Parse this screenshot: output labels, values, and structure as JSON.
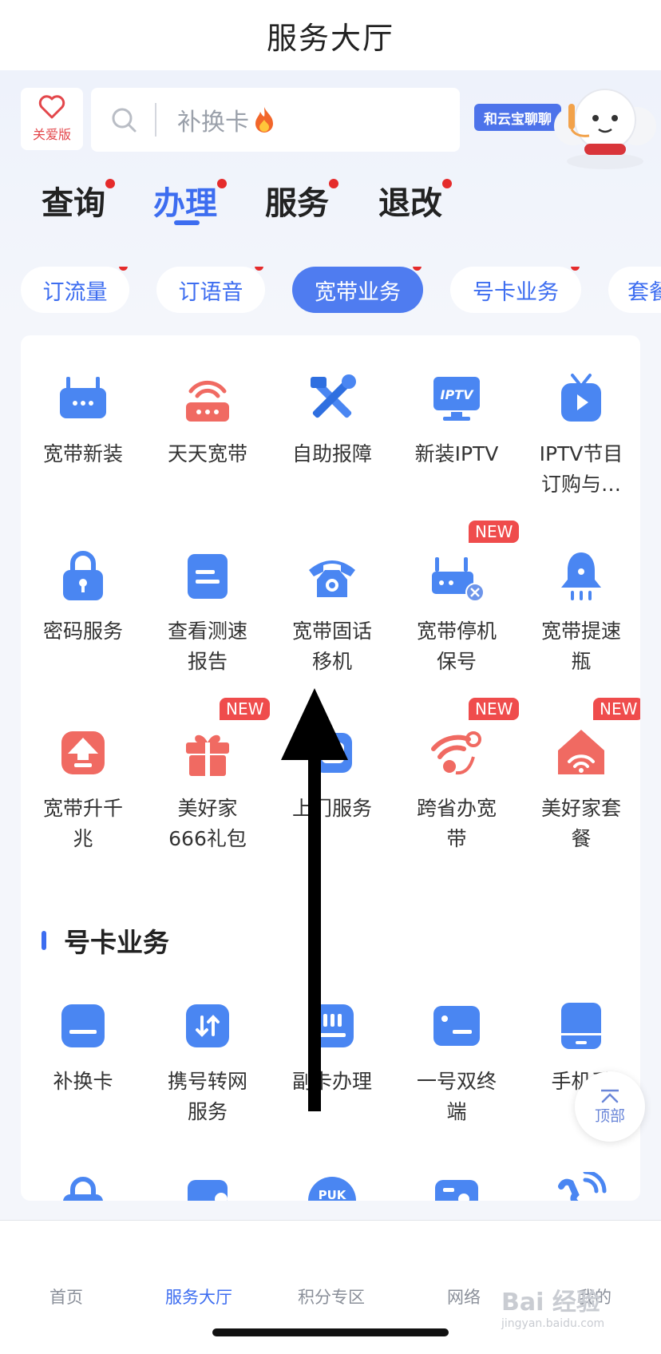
{
  "header": {
    "title": "服务大厅"
  },
  "care_mode": {
    "label": "关爱版"
  },
  "search": {
    "placeholder": "补换卡"
  },
  "chat": {
    "label": "和云宝聊聊"
  },
  "main_tabs": [
    {
      "label": "查询"
    },
    {
      "label": "办理"
    },
    {
      "label": "服务"
    },
    {
      "label": "退改"
    }
  ],
  "chips": [
    {
      "label": "订流量"
    },
    {
      "label": "订语音"
    },
    {
      "label": "宽带业务"
    },
    {
      "label": "号卡业务"
    },
    {
      "label": "套餐"
    }
  ],
  "broadband": [
    {
      "label": "宽带新装",
      "icon": "router-icon"
    },
    {
      "label": "天天宽带",
      "icon": "wifi-router-icon"
    },
    {
      "label": "自助报障",
      "icon": "tools-icon"
    },
    {
      "label": "新装IPTV",
      "icon": "iptv-icon"
    },
    {
      "label": "IPTV节目\n订购与…",
      "icon": "tv-play-icon"
    },
    {
      "label": "密码服务",
      "icon": "lock-icon"
    },
    {
      "label": "查看测速\n报告",
      "icon": "report-icon"
    },
    {
      "label": "宽带固话\n移机",
      "icon": "telephone-icon"
    },
    {
      "label": "宽带停机\n保号",
      "icon": "router-stop-icon",
      "badge": "NEW"
    },
    {
      "label": "宽带提速\n瓶",
      "icon": "bell-icon"
    },
    {
      "label": "宽带升千\n兆",
      "icon": "upgrade-icon"
    },
    {
      "label": "美好家\n666礼包",
      "icon": "gift-icon",
      "badge": "NEW"
    },
    {
      "label": "上门服务",
      "icon": "onsite-icon"
    },
    {
      "label": "跨省办宽\n带",
      "icon": "wifi-signal-icon",
      "badge": "NEW"
    },
    {
      "label": "美好家套\n餐",
      "icon": "home-wifi-icon",
      "badge": "NEW"
    }
  ],
  "card_section": {
    "title": "号卡业务",
    "items": [
      {
        "label": "补换卡",
        "icon": "sim-card-icon"
      },
      {
        "label": "携号转网\n服务",
        "icon": "transfer-icon"
      },
      {
        "label": "副卡办理",
        "icon": "sub-card-icon"
      },
      {
        "label": "一号双终\n端",
        "icon": "dual-terminal-icon"
      },
      {
        "label": "手机丢",
        "icon": "phone-icon"
      }
    ]
  },
  "back_top": {
    "label": "顶部"
  },
  "bottom_nav": [
    {
      "label": "首页"
    },
    {
      "label": "服务大厅"
    },
    {
      "label": "积分专区"
    },
    {
      "label": "网络"
    },
    {
      "label": "我的"
    }
  ],
  "watermark": {
    "line1": "Bai 经验",
    "line2": "jingyan.baidu.com"
  },
  "colors": {
    "accent": "#3d6df0",
    "red": "#e3474b",
    "badge": "#ef4c4c"
  }
}
